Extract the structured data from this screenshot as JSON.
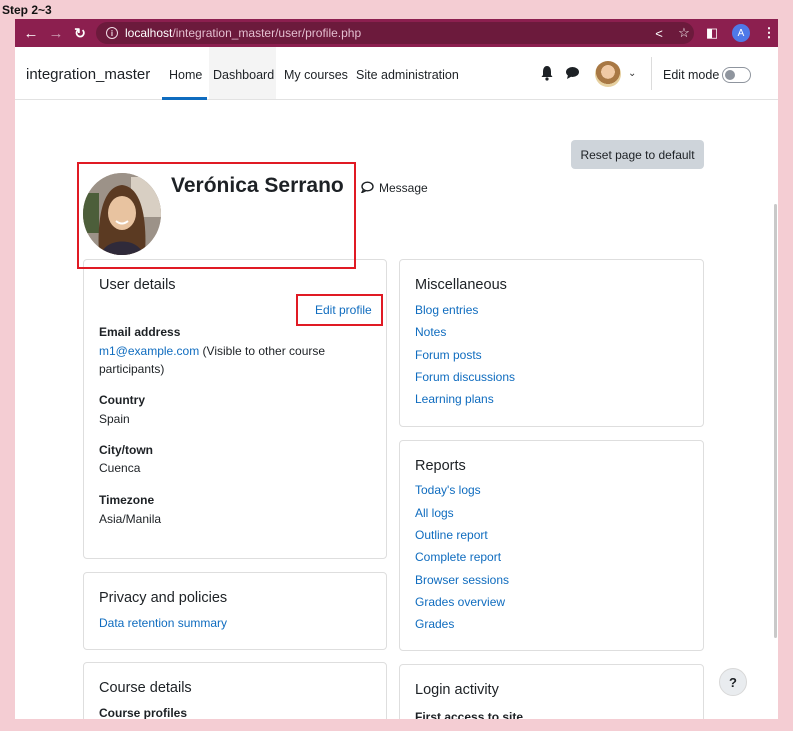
{
  "step_label": "Step 2~3",
  "browser": {
    "url_host": "localhost",
    "url_path": "/integration_master/user/profile.php",
    "profile_initial": "A"
  },
  "navbar": {
    "brand": "integration_master",
    "links": [
      "Home",
      "Dashboard",
      "My courses",
      "Site administration"
    ],
    "edit_mode_label": "Edit mode"
  },
  "page": {
    "reset_button": "Reset page to default",
    "user_name": "Verónica Serrano",
    "message_label": "Message",
    "help_label": "?"
  },
  "user_details": {
    "title": "User details",
    "edit_profile": "Edit profile",
    "email_label": "Email address",
    "email_value": "m1@example.com",
    "email_note_1": " (Visible to other course",
    "email_note_2": "participants)",
    "country_label": "Country",
    "country_value": "Spain",
    "city_label": "City/town",
    "city_value": "Cuenca",
    "timezone_label": "Timezone",
    "timezone_value": "Asia/Manila"
  },
  "miscellaneous": {
    "title": "Miscellaneous",
    "links": [
      "Blog entries",
      "Notes",
      "Forum posts",
      "Forum discussions",
      "Learning plans"
    ]
  },
  "reports": {
    "title": "Reports",
    "links": [
      "Today's logs",
      "All logs",
      "Outline report",
      "Complete report",
      "Browser sessions",
      "Grades overview",
      "Grades"
    ]
  },
  "privacy": {
    "title": "Privacy and policies",
    "link": "Data retention summary"
  },
  "course_details": {
    "title": "Course details",
    "subtitle": "Course profiles"
  },
  "login_activity": {
    "title": "Login activity",
    "subtitle": "First access to site"
  },
  "colors": {
    "browser_bar": "#8c1f4f",
    "link": "#0f6cbf",
    "highlight": "#e01a24",
    "background": "#f4cdd3"
  }
}
